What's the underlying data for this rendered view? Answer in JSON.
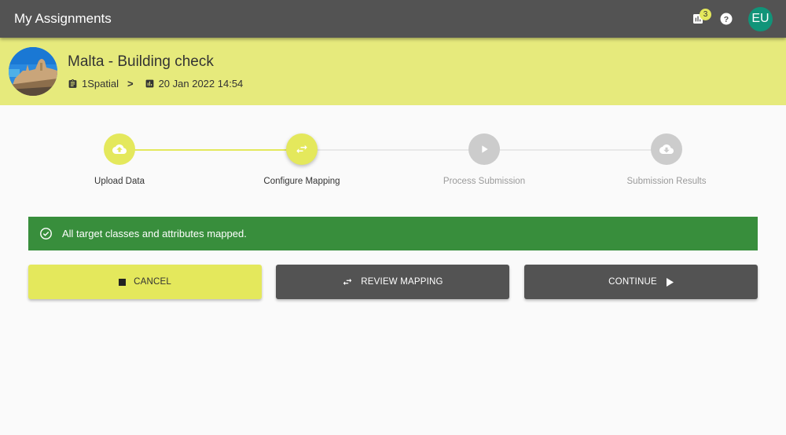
{
  "appbar": {
    "title": "My Assignments",
    "notification_count": "3",
    "avatar_initials": "EU",
    "icons": [
      "bar-chart-icon",
      "help-icon"
    ]
  },
  "project": {
    "title": "Malta - Building check",
    "organization": "1Spatial",
    "organization_icon": "clipboard-icon",
    "separator": ">",
    "date": "20 Jan 2022 14:54",
    "date_icon": "bar-chart-icon"
  },
  "stepper": {
    "steps": [
      {
        "label": "Upload Data",
        "icon": "cloud-upload-icon",
        "state": "completed"
      },
      {
        "label": "Configure Mapping",
        "icon": "swap-arrows-icon",
        "state": "active"
      },
      {
        "label": "Process Submission",
        "icon": "play-icon",
        "state": "pending"
      },
      {
        "label": "Submission Results",
        "icon": "cloud-download-icon",
        "state": "pending"
      }
    ]
  },
  "alert": {
    "message": "All target classes and attributes mapped.",
    "icon": "check-circle-icon",
    "type": "success"
  },
  "actions": {
    "cancel_label": "CANCEL",
    "review_label": "REVIEW MAPPING",
    "continue_label": "CONTINUE"
  },
  "colors": {
    "appbar": "#535353",
    "accent": "#e4e85c",
    "band": "#e6ea7c",
    "success": "#388e3c",
    "avatar": "#119479",
    "pending": "#cccccc"
  }
}
